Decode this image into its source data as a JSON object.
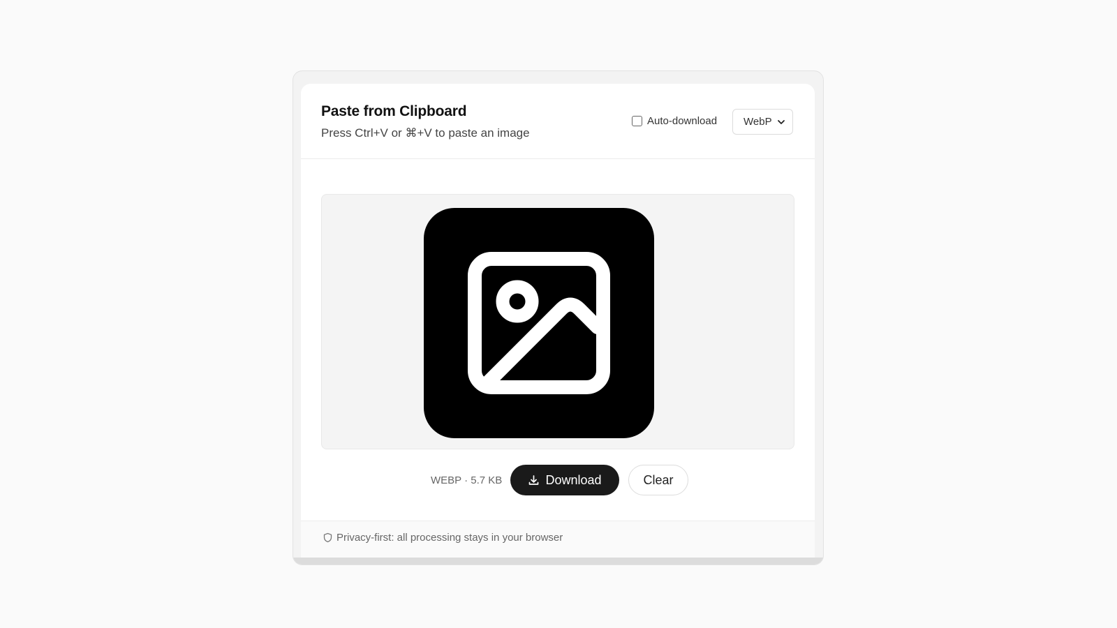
{
  "header": {
    "title": "Paste from Clipboard",
    "subtitle": "Press Ctrl+V or ⌘+V to paste an image",
    "auto_download_label": "Auto-download",
    "auto_download_checked": false,
    "format_selected": "WebP"
  },
  "preview": {
    "image_icon": "image-icon"
  },
  "actions": {
    "meta": "WEBP · 5.7 KB",
    "download_label": "Download",
    "clear_label": "Clear"
  },
  "footer": {
    "privacy_text": "Privacy-first: all processing stays in your browser",
    "privacy_icon": "shield-icon"
  },
  "colors": {
    "page_bg": "#fafafa",
    "primary_button": "#1a1a1a",
    "preview_bg": "#f4f4f4"
  }
}
